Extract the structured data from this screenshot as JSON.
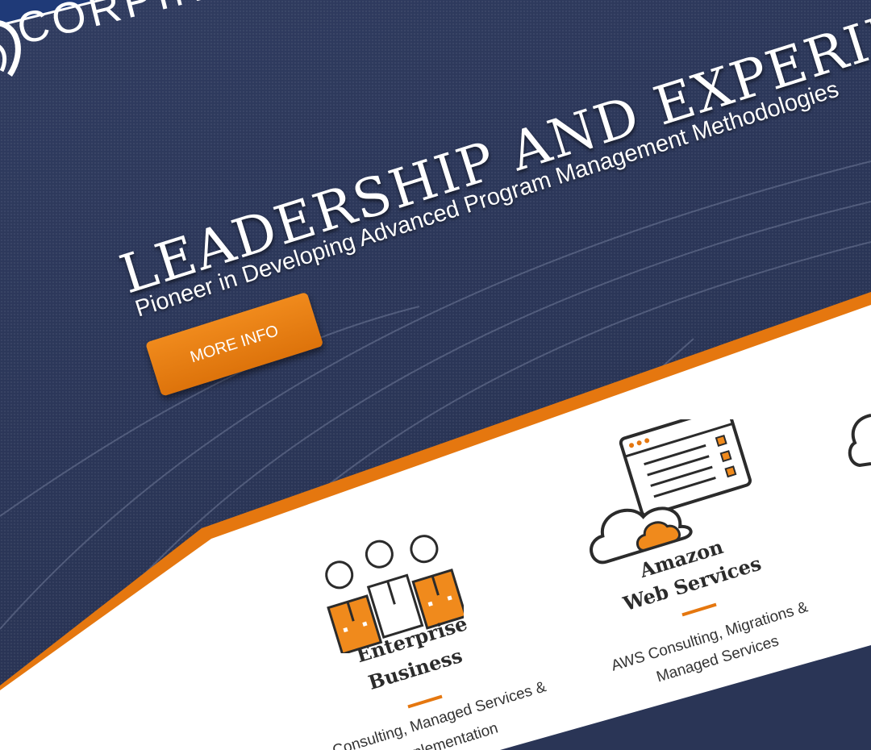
{
  "header": {
    "logo_text": "CORPINA"
  },
  "hero": {
    "title": "LEADERSHIP AND EXPERIENCE",
    "subtitle": "Pioneer in Developing Advanced Program Management Methodologies",
    "button_label": "MORE INFO"
  },
  "services": [
    {
      "title_line1": "Enterprise",
      "title_line2": "Business",
      "desc_line1": "Consulting, Managed Services &",
      "desc_line2": "Implementation",
      "icon": "team-people-icon"
    },
    {
      "title_line1": "Amazon",
      "title_line2": "Web Services",
      "desc_line1": "AWS Consulting, Migrations &",
      "desc_line2": "Managed Services",
      "icon": "cloud-browser-icon"
    }
  ],
  "colors": {
    "navy": "#2a3556",
    "header_blue": "#1f3a78",
    "accent_orange": "#e5770f",
    "panel_white": "#ffffff"
  }
}
